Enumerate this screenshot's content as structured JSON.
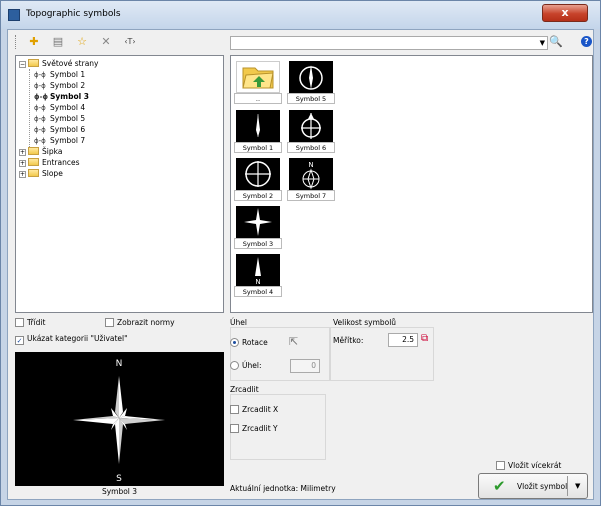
{
  "window": {
    "title": "Topographic symbols",
    "close": "x"
  },
  "toolbar": {
    "icons": [
      "add-icon",
      "grid-icon",
      "star-icon",
      "delete-icon",
      "text-icon"
    ],
    "glyphs": [
      "✚",
      "▤",
      "☆",
      "✕",
      "‹T›"
    ],
    "search_value": "",
    "search_glyph": "🔍",
    "help_glyph": "?"
  },
  "tree": {
    "root": "Světové strany",
    "children": [
      "Symbol 1",
      "Symbol 2",
      "Symbol 3",
      "Symbol 4",
      "Symbol 5",
      "Symbol 6",
      "Symbol 7"
    ],
    "selected": "Symbol 3",
    "folders": [
      "Šipka",
      "Entrances",
      "Slope"
    ]
  },
  "grid": {
    "folder_up_label": "..",
    "tiles": [
      "Symbol 5",
      "Symbol 1",
      "Symbol 6",
      "Symbol 2",
      "Symbol 7",
      "Symbol 3",
      "Symbol 4"
    ]
  },
  "options": {
    "sort": "Třídit",
    "show_norms": "Zobrazit normy",
    "show_category": "Ukázat kategorii \"Uživatel\"",
    "show_category_checked": true
  },
  "preview": {
    "north": "N",
    "south": "S",
    "caption": "Symbol 3"
  },
  "angle": {
    "title": "Úhel",
    "rotation": "Rotace",
    "angle_label": "Úhel:",
    "angle_value": "0"
  },
  "size": {
    "title": "Velikost symbolů",
    "scale_label": "Měřítko:",
    "scale_value": "2.5"
  },
  "mirror": {
    "title": "Zrcadlit",
    "mirror_x": "Zrcadlit X",
    "mirror_y": "Zrcadlit Y"
  },
  "footer": {
    "units": "Aktuální jednotka: Milimetry",
    "insert_multiple": "Vložit vícekrát",
    "insert_button": "Vložit symbol"
  }
}
